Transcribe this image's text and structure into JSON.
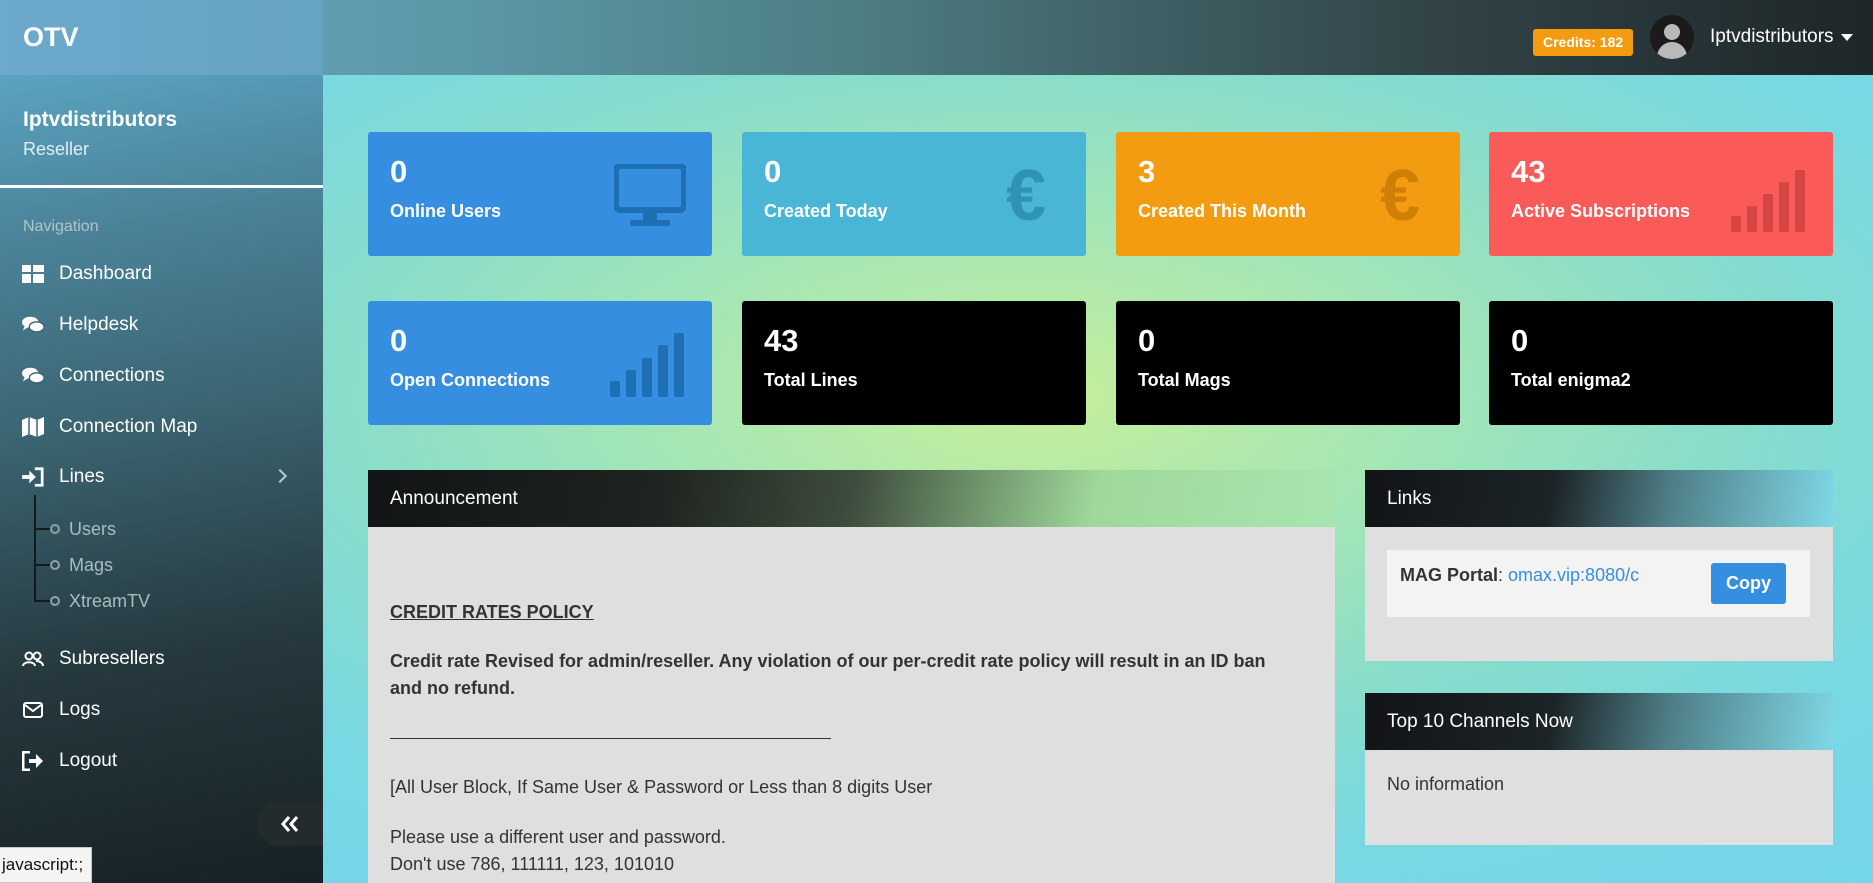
{
  "topbar": {
    "brand": "OTV",
    "credits": "Credits: 182",
    "username": "Iptvdistributors"
  },
  "sidebar": {
    "profile_name": "Iptvdistributors",
    "profile_role": "Reseller",
    "nav_heading": "Navigation",
    "items": [
      {
        "label": "Dashboard",
        "icon": "dashboard-icon"
      },
      {
        "label": "Helpdesk",
        "icon": "comments-icon"
      },
      {
        "label": "Connections",
        "icon": "comments-icon"
      },
      {
        "label": "Connection Map",
        "icon": "map-icon"
      },
      {
        "label": "Lines",
        "icon": "sign-in-icon"
      },
      {
        "label": "Subresellers",
        "icon": "users-icon"
      },
      {
        "label": "Logs",
        "icon": "envelope-icon"
      },
      {
        "label": "Logout",
        "icon": "sign-out-icon"
      }
    ],
    "lines_subitems": [
      "Users",
      "Mags",
      "XtreamTV"
    ]
  },
  "status_bar_url": "javascript:;",
  "stats": [
    {
      "value": "0",
      "label": "Online Users",
      "icon": "monitor-icon"
    },
    {
      "value": "0",
      "label": "Created Today",
      "icon": "euro-icon"
    },
    {
      "value": "3",
      "label": "Created This Month",
      "icon": "euro-icon"
    },
    {
      "value": "43",
      "label": "Active Subscriptions",
      "icon": "signal-bars-icon"
    },
    {
      "value": "0",
      "label": "Open Connections",
      "icon": "signal-bars-icon"
    },
    {
      "value": "43",
      "label": "Total Lines"
    },
    {
      "value": "0",
      "label": "Total Mags"
    },
    {
      "value": "0",
      "label": "Total enigma2"
    }
  ],
  "announcement": {
    "title": "Announcement",
    "policy_heading": "CREDIT RATES POLICY",
    "policy_bold": "Credit rate Revised for admin/reseller. Any violation of our per-credit rate policy will result in an ID ban and no refund.",
    "line1": "[All User Block, If Same User & Password or Less than 8 digits User",
    "line2": "Please use a different user and password.",
    "line3": "Don't use 786, 111111, 123, 101010"
  },
  "links": {
    "title": "Links",
    "mag_label": "MAG Portal",
    "mag_url": "omax.vip:8080/c",
    "copy_label": "Copy"
  },
  "top_channels": {
    "title": "Top 10 Channels Now",
    "empty_text": "No information"
  },
  "colors": {
    "blue": "#368ee0",
    "teal": "#49b6d6",
    "orange": "#f39c12",
    "red": "#fa5a58",
    "black": "#000000"
  }
}
